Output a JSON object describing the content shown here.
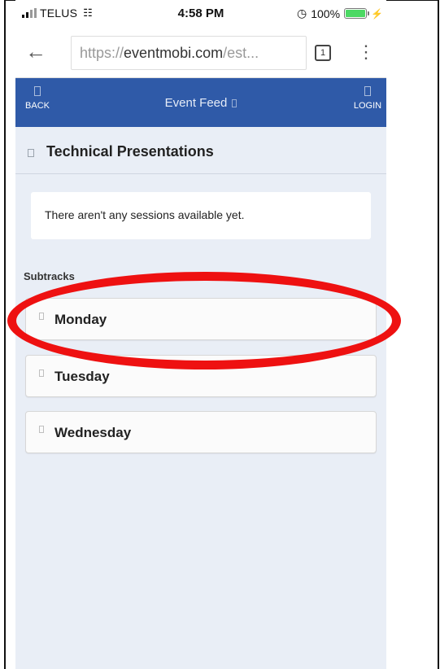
{
  "status_bar": {
    "carrier": "TELUS",
    "time": "4:58 PM",
    "battery": "100%",
    "battery_level": 1.0,
    "battery_color": "#4cd964"
  },
  "browser": {
    "url_prefix": "https://",
    "url_host": "eventmobi.com",
    "url_rest": "/est...",
    "tab_count": "1"
  },
  "header": {
    "back_label": "BACK",
    "title": "Event Feed",
    "login_label": "LOGIN",
    "color": "#2f5aa8"
  },
  "page": {
    "heading": "Technical Presentations",
    "empty_message": "There aren't any sessions available yet.",
    "subtracks_label": "Subtracks",
    "subtracks": [
      {
        "label": "Monday"
      },
      {
        "label": "Tuesday"
      },
      {
        "label": "Wednesday"
      }
    ]
  },
  "annotation": {
    "highlight_color": "#ee1111"
  }
}
